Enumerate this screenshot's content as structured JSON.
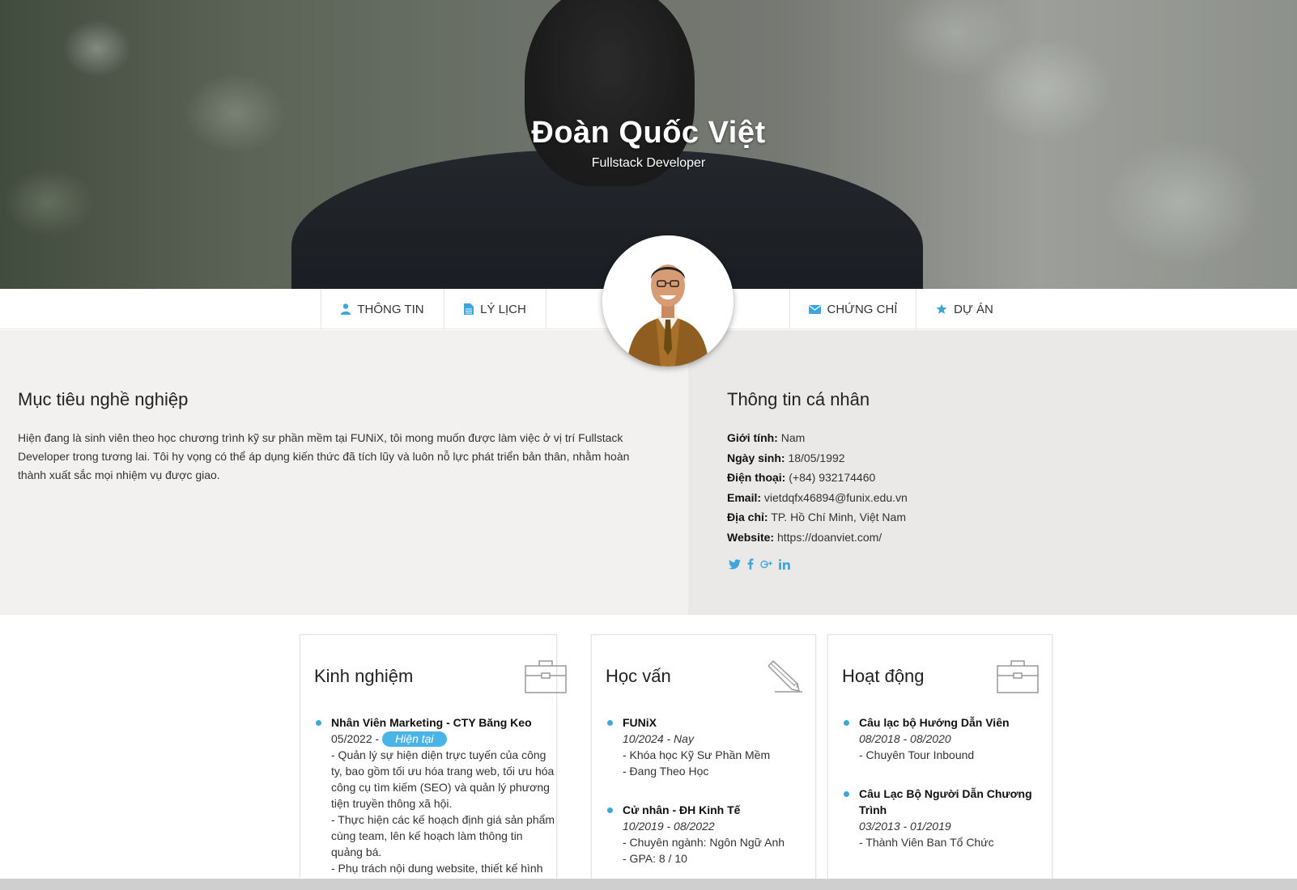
{
  "header": {
    "name": "Đoàn Quốc Việt",
    "role": "Fullstack Developer"
  },
  "nav": {
    "items": [
      {
        "label": "THÔNG TIN",
        "icon": "user-icon"
      },
      {
        "label": "LÝ LỊCH",
        "icon": "file-icon"
      },
      {
        "label": "CHỨNG CHỈ",
        "icon": "envelope-icon"
      },
      {
        "label": "DỰ ÁN",
        "icon": "star-icon"
      }
    ]
  },
  "objective": {
    "title": "Mục tiêu nghề nghiệp",
    "text": "Hiện đang là sinh viên theo học chương trình kỹ sư phần mềm tại FUNiX, tôi mong muốn được làm việc ở vị trí Fullstack Developer trong tương lai. Tôi hy vọng có thể áp dụng kiến thức đã tích lũy và luôn nỗ lực phát triển bản thân, nhằm hoàn thành xuất sắc mọi nhiệm vụ được giao."
  },
  "personal": {
    "title": "Thông tin cá nhân",
    "fields": [
      {
        "label": "Giới tính:",
        "value": "Nam"
      },
      {
        "label": "Ngày sinh:",
        "value": "18/05/1992"
      },
      {
        "label": "Điện thoại:",
        "value": "(+84) 932174460"
      },
      {
        "label": "Email:",
        "value": "vietdqfx46894@funix.edu.vn"
      },
      {
        "label": "Địa chỉ:",
        "value": "TP. Hồ Chí Minh, Việt Nam"
      },
      {
        "label": "Website:",
        "value": "https://doanviet.com/"
      }
    ],
    "socials": [
      "twitter-icon",
      "facebook-icon",
      "google-plus-icon",
      "linkedin-icon"
    ]
  },
  "experience": {
    "title": "Kinh nghiệm",
    "entries": [
      {
        "title": "Nhân Viên Marketing - CTY Băng Keo",
        "date": "05/2022 -",
        "badge": "Hiện tại",
        "lines": [
          "- Quản lý sự hiện diện trực tuyến của công ty, bao gồm tối ưu hóa trang web, tối ưu hóa công cụ tìm kiếm (SEO) và quản lý phương tiện truyền thông xã hội.",
          "- Thực hiện các kế hoạch định giá sản phẩm cùng team, lên kế hoạch làm thông tin quảng bá.",
          "- Phụ trách nội dung website, thiết kế hình"
        ]
      }
    ]
  },
  "education": {
    "title": "Học vấn",
    "entries": [
      {
        "title": "FUNiX",
        "date": "10/2024 - Nay",
        "lines": [
          "- Khóa học Kỹ Sư Phần Mềm",
          "- Đang Theo Học"
        ]
      },
      {
        "title": "Cử nhân - ĐH Kinh Tế",
        "date": "10/2019 - 08/2022",
        "lines": [
          "- Chuyên ngành: Ngôn Ngữ Anh",
          "- GPA: 8 / 10"
        ]
      }
    ]
  },
  "activities": {
    "title": "Hoạt động",
    "entries": [
      {
        "title": "Câu lạc bộ Hướng Dẫn Viên",
        "date": "08/2018 - 08/2020",
        "lines": [
          "- Chuyên Tour Inbound"
        ]
      },
      {
        "title": "Câu Lạc Bộ Người Dẫn Chương Trình",
        "date": "03/2013 - 01/2019",
        "lines": [
          "- Thành Viên Ban Tổ Chức"
        ]
      }
    ]
  },
  "colors": {
    "accent": "#3ea6d8",
    "badge": "#4ab4e6"
  }
}
